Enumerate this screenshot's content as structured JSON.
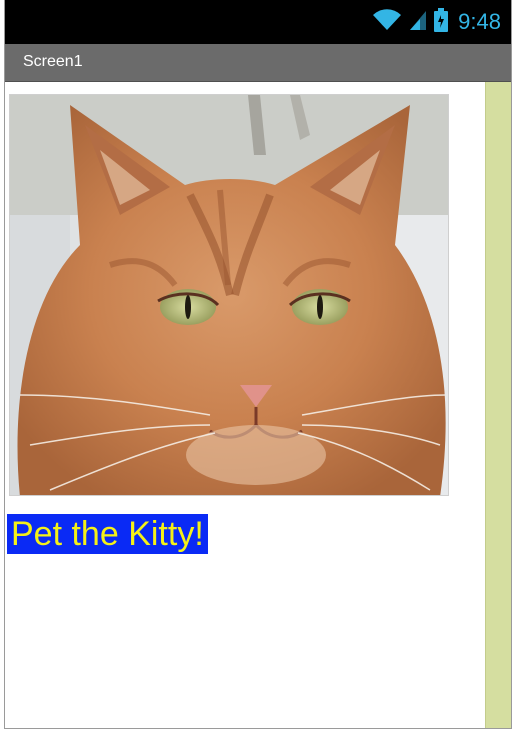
{
  "status_bar": {
    "time": "9:48",
    "wifi_icon": "wifi-icon",
    "signal_icon": "cell-signal-icon",
    "battery_icon": "battery-icon",
    "icon_color": "#33b5e5",
    "background": "#000000"
  },
  "title_bar": {
    "title": "Screen1",
    "background": "#6b6b6b"
  },
  "content": {
    "image": {
      "subject": "orange tabby cat face photo"
    },
    "button": {
      "label": "Pet the Kitty!",
      "background": "#0a2af5",
      "text_color": "#f5f117"
    },
    "scroll_rail_color": "#d5dea0"
  }
}
